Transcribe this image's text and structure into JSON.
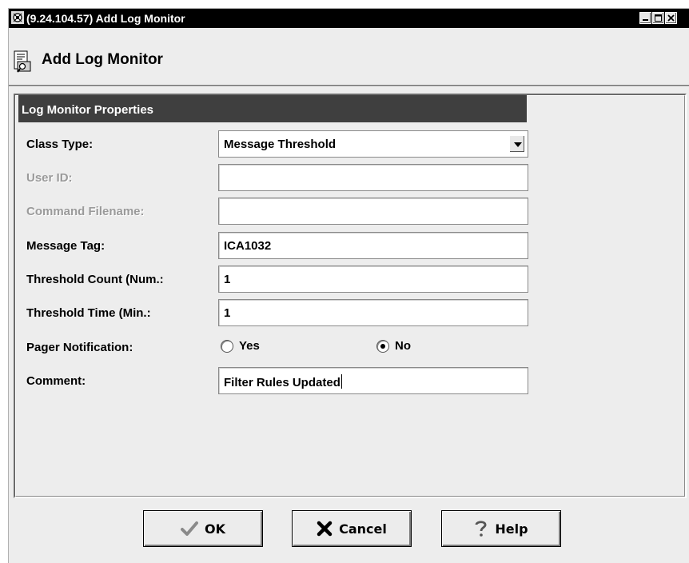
{
  "window": {
    "title": "(9.24.104.57) Add Log Monitor",
    "controls": [
      "minimize-icon",
      "maximize-icon",
      "close-icon"
    ]
  },
  "header": {
    "title": "Add Log Monitor",
    "icon": "log-monitor-icon"
  },
  "section": {
    "title": "Log Monitor Properties"
  },
  "form": {
    "class_type": {
      "label": "Class Type:",
      "value": "Message Threshold"
    },
    "user_id": {
      "label": "User ID:",
      "value": "",
      "disabled": true
    },
    "command_filename": {
      "label": "Command Filename:",
      "value": "",
      "disabled": true
    },
    "message_tag": {
      "label": "Message Tag:",
      "value": "ICA1032"
    },
    "threshold_count": {
      "label": "Threshold Count (Num.:",
      "value": "1"
    },
    "threshold_time": {
      "label": "Threshold Time (Min.:",
      "value": "1"
    },
    "pager_notification": {
      "label": "Pager Notification:",
      "options": [
        {
          "label": "Yes",
          "selected": false
        },
        {
          "label": "No",
          "selected": true
        }
      ]
    },
    "comment": {
      "label": "Comment:",
      "value": "Filter Rules Updated"
    }
  },
  "buttons": {
    "ok": {
      "label": "OK",
      "icon": "checkmark-icon"
    },
    "cancel": {
      "label": "Cancel",
      "icon": "x-icon"
    },
    "help": {
      "label": "Help",
      "icon": "question-icon"
    }
  },
  "colors": {
    "titlebar": "#000000",
    "section_header": "#3f3f3f",
    "background": "#ededed"
  }
}
